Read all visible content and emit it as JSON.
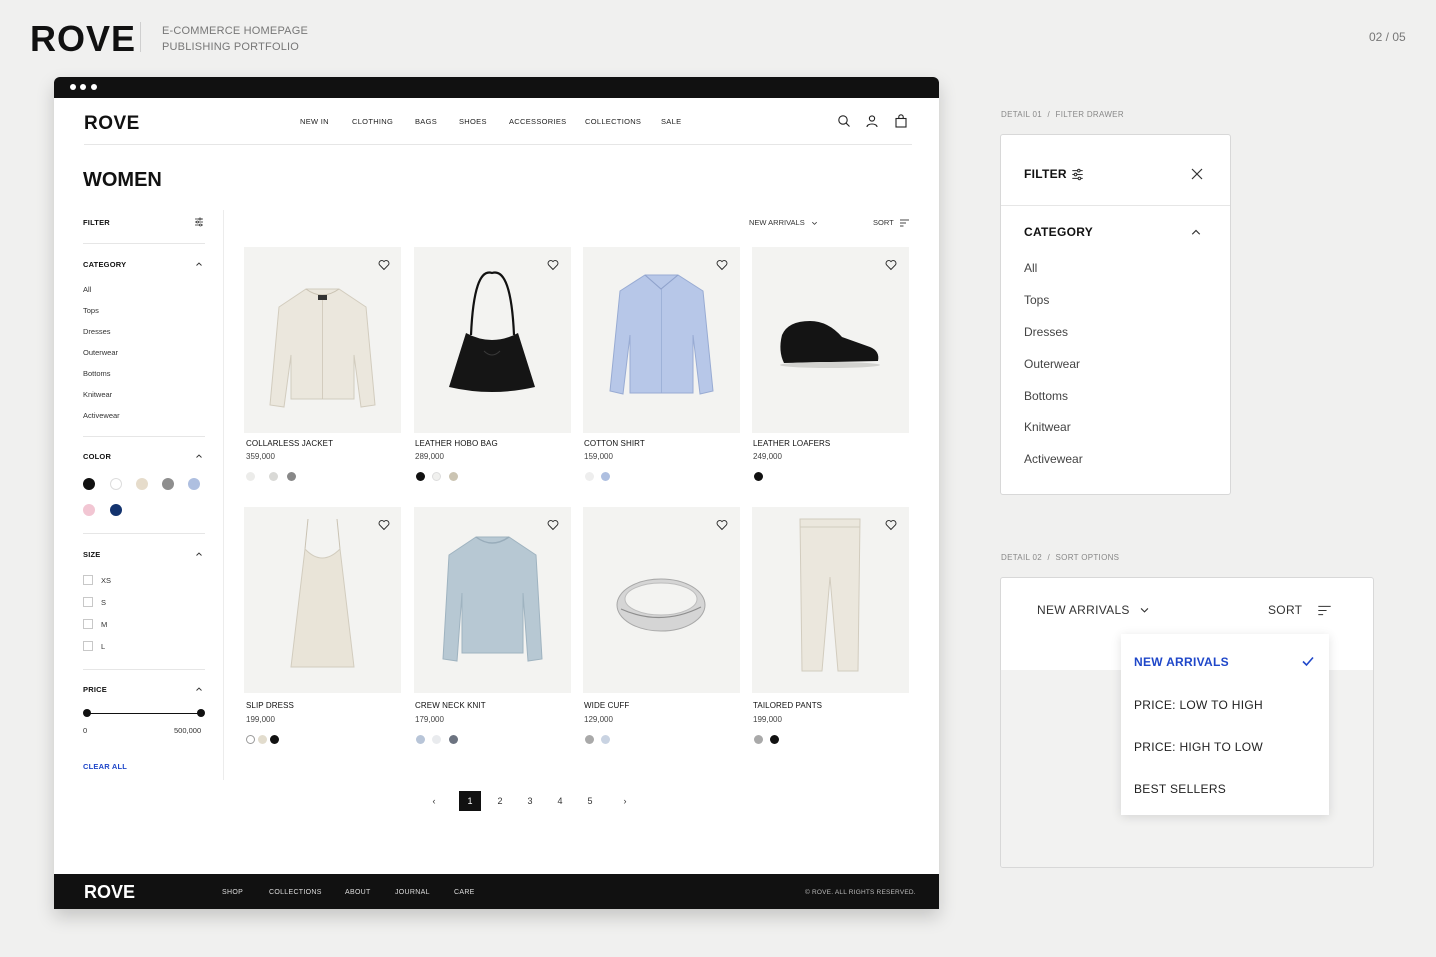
{
  "portfolio": {
    "brand": "ROVE",
    "subtitle_line1": "E-COMMERCE HOMEPAGE",
    "subtitle_line2": "PUBLISHING PORTFOLIO",
    "page_indicator": "02 / 05"
  },
  "site": {
    "logo": "ROVE",
    "nav": [
      "NEW IN",
      "CLOTHING",
      "BAGS",
      "SHOES",
      "ACCESSORIES",
      "COLLECTIONS",
      "SALE"
    ],
    "icons": [
      "search-icon",
      "user-icon",
      "bag-icon"
    ],
    "page_title": "WOMEN"
  },
  "sidebar": {
    "filter_label": "FILTER",
    "category_label": "CATEGORY",
    "categories": [
      "All",
      "Tops",
      "Dresses",
      "Outerwear",
      "Bottoms",
      "Knitwear",
      "Activewear"
    ],
    "color_label": "COLOR",
    "colors": [
      "#111111",
      "#ffffff",
      "#e6dccb",
      "#8e8e8e",
      "#aebfe0",
      "#f2c6d3",
      "#13336e"
    ],
    "size_label": "SIZE",
    "sizes": [
      "XS",
      "S",
      "M",
      "L"
    ],
    "price_label": "PRICE",
    "price_min": "0",
    "price_max": "500,000",
    "clear_all": "CLEAR ALL"
  },
  "toolbar": {
    "sort_value": "NEW ARRIVALS",
    "sort_label": "SORT"
  },
  "products": [
    {
      "name": "COLLARLESS JACKET",
      "price": "359,000",
      "swatches": [
        "#ececea",
        "#d9d9d6",
        "#888888"
      ]
    },
    {
      "name": "LEATHER HOBO BAG",
      "price": "289,000",
      "swatches": [
        "#111111",
        "#f0f0ee",
        "#cbc4b2"
      ]
    },
    {
      "name": "COTTON SHIRT",
      "price": "159,000",
      "swatches": [
        "#eeeeee",
        "#aebfe0"
      ]
    },
    {
      "name": "LEATHER LOAFERS",
      "price": "249,000",
      "swatches": [
        "#111111"
      ]
    },
    {
      "name": "SLIP DRESS",
      "price": "199,000",
      "swatches": [
        "#ffffff",
        "#e2dccd",
        "#111111"
      ]
    },
    {
      "name": "CREW NECK KNIT",
      "price": "179,000",
      "swatches": [
        "#b8c5d8",
        "#e9ebee",
        "#6c7380"
      ]
    },
    {
      "name": "WIDE CUFF",
      "price": "129,000",
      "swatches": [
        "#a9a9a9",
        "#c9d3e2"
      ]
    },
    {
      "name": "TAILORED PANTS",
      "price": "199,000",
      "swatches": [
        "#a9a9a9",
        "#111111"
      ]
    }
  ],
  "pagination": {
    "pages": [
      "1",
      "2",
      "3",
      "4",
      "5"
    ],
    "current": "1",
    "prev": "‹",
    "next": "›"
  },
  "footer": {
    "logo": "ROVE",
    "links": [
      "SHOP",
      "COLLECTIONS",
      "ABOUT",
      "JOURNAL",
      "CARE"
    ],
    "copyright": "© ROVE. ALL RIGHTS RESERVED."
  },
  "detail1": {
    "label_num": "DETAIL 01",
    "label_sep": "/",
    "label_name": "FILTER DRAWER",
    "title": "FILTER",
    "section": "CATEGORY",
    "items": [
      "All",
      "Tops",
      "Dresses",
      "Outerwear",
      "Bottoms",
      "Knitwear",
      "Activewear"
    ]
  },
  "detail2": {
    "label_num": "DETAIL 02",
    "label_sep": "/",
    "label_name": "SORT OPTIONS",
    "sort_value": "NEW ARRIVALS",
    "sort_label": "SORT",
    "options": [
      "NEW ARRIVALS",
      "PRICE: LOW TO HIGH",
      "PRICE: HIGH TO LOW",
      "BEST SELLERS"
    ],
    "selected": "NEW ARRIVALS",
    "accent_color": "#1f47c9"
  }
}
